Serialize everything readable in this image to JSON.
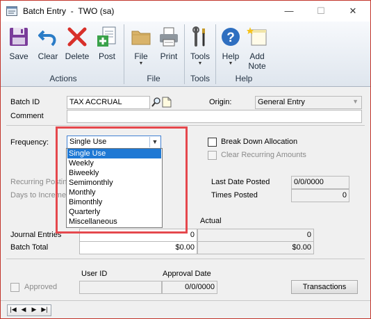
{
  "window": {
    "title": "Batch Entry",
    "company": "TWO (sa)",
    "minimize_glyph": "—",
    "maximize_glyph": "☐",
    "close_glyph": "✕"
  },
  "ribbon": {
    "buttons": [
      {
        "label": "Save",
        "icon": "save-icon"
      },
      {
        "label": "Clear",
        "icon": "undo-icon"
      },
      {
        "label": "Delete",
        "icon": "delete-x-icon"
      },
      {
        "label": "Post",
        "icon": "post-icon"
      },
      {
        "label": "File",
        "icon": "folder-icon"
      },
      {
        "label": "Print",
        "icon": "printer-icon"
      },
      {
        "label": "Tools",
        "icon": "tools-icon"
      },
      {
        "label": "Help",
        "icon": "help-icon"
      },
      {
        "label": "Add",
        "label2": "Note",
        "icon": "add-note-icon"
      }
    ],
    "groups": [
      "Actions",
      "File",
      "Tools",
      "Help"
    ]
  },
  "form": {
    "batch_id_label": "Batch ID",
    "batch_id_value": "TAX ACCRUAL",
    "origin_label": "Origin:",
    "origin_value": "General Entry",
    "comment_label": "Comment",
    "comment_value": "",
    "frequency_label": "Frequency:",
    "frequency_value": "Single Use",
    "frequency_options": [
      "Single Use",
      "Weekly",
      "Biweekly",
      "Semimonthly",
      "Monthly",
      "Bimonthly",
      "Quarterly",
      "Miscellaneous"
    ],
    "break_down_label": "Break Down Allocation",
    "clear_recurring_label": "Clear Recurring Amounts",
    "recurring_posting_label": "Recurring Posting",
    "days_to_increment_label": "Days to Increment",
    "last_date_posted_label": "Last Date Posted",
    "last_date_posted_value": "0/0/0000",
    "times_posted_label": "Times Posted",
    "times_posted_value": "0",
    "actual_header": "Actual",
    "journal_entries_label": "Journal Entries",
    "journal_entries_control": "0",
    "journal_entries_actual": "0",
    "batch_total_label": "Batch Total",
    "batch_total_control": "$0.00",
    "batch_total_actual": "$0.00",
    "user_id_label": "User ID",
    "approval_date_label": "Approval Date",
    "approval_date_value": "0/0/0000",
    "approved_label": "Approved",
    "transactions_button": "Transactions"
  }
}
